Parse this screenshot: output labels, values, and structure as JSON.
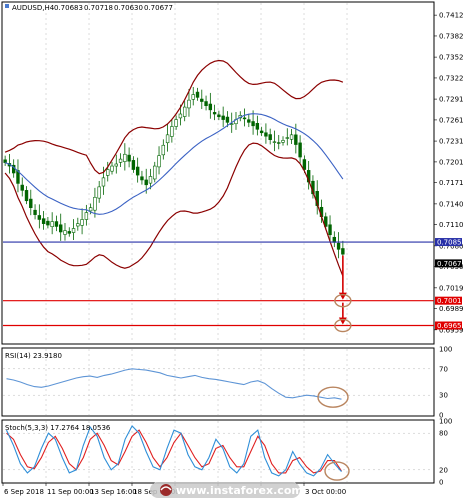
{
  "header": {
    "symbol": "AUDUSD,H4",
    "open": "0.70683",
    "high": "0.70718",
    "low": "0.70630",
    "close": "0.70677"
  },
  "colors": {
    "candle": "#006400",
    "bollinger": "#8b0000",
    "moving_average": "#3b62c4",
    "level_line": "#2830a8",
    "support_line": "#e00000",
    "arrow": "#d40000",
    "ellipse": "#b9855f",
    "rsi_line": "#5e95d6",
    "stoch_main": "#2f8fd8",
    "stoch_signal": "#e02020",
    "price_box": "#000000",
    "level_box": "#2830a8",
    "support_box": "#e00000"
  },
  "price_axis": {
    "ticks": [
      "0.74125",
      "0.73825",
      "0.73520",
      "0.73220",
      "0.72915",
      "0.72615",
      "0.72310",
      "0.72010",
      "0.71710",
      "0.71405",
      "0.71105",
      "0.70800",
      "0.70500",
      "0.70195",
      "0.69895",
      "0.69590"
    ],
    "level_label": "0.70855",
    "current_price_label": "0.70677",
    "support1_label": "0.70010",
    "support2_label": "0.69652"
  },
  "time_axis": [
    "6 Sep 2018",
    "11 Sep 00:00",
    "13 Sep 16:00",
    "18 Sep 08:00",
    "",
    "",
    "",
    "3 Oct 00:00"
  ],
  "rsi": {
    "label": "RSI(14) 23.9180",
    "scale": [
      "100",
      "70",
      "30",
      "0"
    ]
  },
  "stoch": {
    "label": "Stoch(5,3,3) 17.2764 18.0536",
    "scale": [
      "100",
      "80",
      "20",
      "0"
    ]
  },
  "watermark": "www.instaforex.com",
  "chart_data": {
    "type": "candlestick",
    "symbol": "AUDUSD",
    "timeframe": "H4",
    "ylim": [
      0.694,
      0.743
    ],
    "horizontal_levels": [
      0.70855,
      0.7001,
      0.69652
    ],
    "price_path": [
      0.72,
      0.7195,
      0.7185,
      0.717,
      0.716,
      0.7145,
      0.7135,
      0.7125,
      0.7118,
      0.7112,
      0.711,
      0.7115,
      0.7108,
      0.71,
      0.7102,
      0.7098,
      0.7105,
      0.7112,
      0.7118,
      0.7128,
      0.7135,
      0.715,
      0.7165,
      0.7178,
      0.719,
      0.7195,
      0.7198,
      0.7205,
      0.7212,
      0.7202,
      0.719,
      0.7182,
      0.7175,
      0.7168,
      0.718,
      0.7195,
      0.721,
      0.7225,
      0.724,
      0.7252,
      0.7262,
      0.727,
      0.728,
      0.729,
      0.7298,
      0.7294,
      0.7288,
      0.7282,
      0.7276,
      0.727,
      0.7266,
      0.7262,
      0.7258,
      0.7256,
      0.7262,
      0.7268,
      0.7263,
      0.7258,
      0.7253,
      0.7248,
      0.7243,
      0.7238,
      0.7233,
      0.723,
      0.7228,
      0.7232,
      0.7236,
      0.724,
      0.7226,
      0.7208,
      0.719,
      0.7172,
      0.7155,
      0.7138,
      0.7122,
      0.7108,
      0.7096,
      0.7085,
      0.7075,
      0.7068
    ],
    "rsi_series": [
      55,
      53,
      50,
      46,
      43,
      42,
      44,
      47,
      50,
      53,
      56,
      58,
      59,
      57,
      60,
      62,
      65,
      68,
      70,
      69,
      68,
      66,
      64,
      60,
      58,
      56,
      58,
      60,
      57,
      55,
      54,
      52,
      50,
      48,
      46,
      50,
      52,
      48,
      40,
      33,
      27,
      26,
      28,
      30,
      29,
      27,
      25,
      26,
      24
    ],
    "stoch_main": [
      85,
      60,
      30,
      15,
      25,
      55,
      80,
      70,
      40,
      15,
      20,
      60,
      90,
      75,
      40,
      20,
      30,
      70,
      92,
      80,
      50,
      25,
      20,
      55,
      85,
      80,
      45,
      25,
      20,
      40,
      70,
      55,
      25,
      15,
      30,
      75,
      85,
      40,
      15,
      10,
      20,
      50,
      30,
      15,
      10,
      22,
      45,
      30,
      17
    ],
    "stoch_signal": [
      80,
      70,
      45,
      25,
      22,
      40,
      65,
      75,
      55,
      30,
      20,
      40,
      70,
      80,
      60,
      35,
      28,
      50,
      75,
      85,
      65,
      40,
      25,
      40,
      65,
      80,
      60,
      40,
      25,
      30,
      55,
      60,
      40,
      25,
      25,
      50,
      75,
      60,
      30,
      15,
      15,
      35,
      40,
      25,
      15,
      18,
      35,
      35,
      18
    ]
  }
}
